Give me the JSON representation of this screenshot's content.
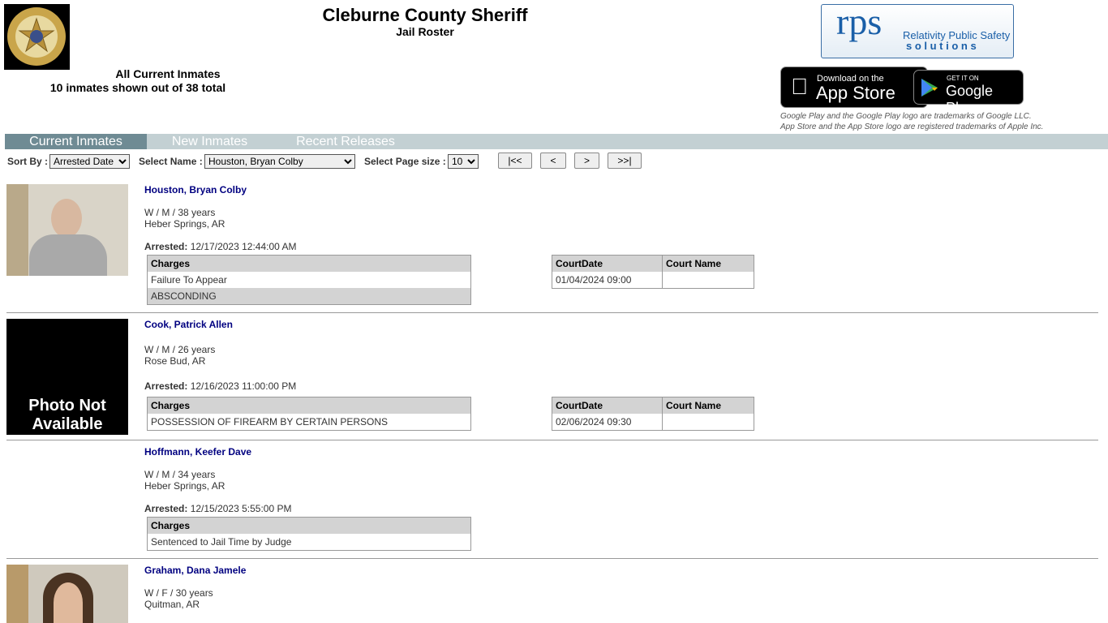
{
  "header": {
    "title": "Cleburne County Sheriff",
    "subtitle": "Jail Roster",
    "seal_text": "SHERIFF'S OFFICE CLEBURNE COUNTY",
    "summary_title": "All Current Inmates",
    "summary_count": "10 inmates shown out of 38 total"
  },
  "vendor": {
    "logo_text": "rps",
    "tagline_1": "Relativity Public Safety",
    "tagline_2": "s o l u t i o n s"
  },
  "apps": {
    "appstore_small": "Download on the",
    "appstore_big": "App Store",
    "gplay_small": "GET IT ON",
    "gplay_big": "Google Play",
    "tm1": "Google Play and the Google Play logo are trademarks of Google LLC.",
    "tm2": "App Store and the App Store logo are registered trademarks of Apple Inc."
  },
  "tabs": [
    {
      "label": "Current Inmates",
      "active": true
    },
    {
      "label": "New Inmates"
    },
    {
      "label": "Recent Releases"
    }
  ],
  "controls": {
    "sort_label": "Sort By :",
    "sort_value": "Arrested Date",
    "name_label": "Select Name :",
    "name_value": "Houston, Bryan Colby",
    "size_label": "Select Page size :",
    "size_value": "10",
    "first": "|<<",
    "prev": "<",
    "next": ">",
    "last": ">>|"
  },
  "labels": {
    "arrested": "Arrested:",
    "charges": "Charges",
    "court_date": "CourtDate",
    "court_name": "Court Name",
    "no_photo": "Photo Not Available"
  },
  "inmates": [
    {
      "name": "Houston, Bryan Colby",
      "demo": "W / M / 38 years",
      "city": "Heber Springs, AR",
      "arrested": "12/17/2023 12:44:00 AM",
      "charges": [
        "Failure To Appear",
        "ABSCONDING"
      ],
      "court": [
        {
          "date": "01/04/2024 09:00",
          "name": ""
        }
      ]
    },
    {
      "name": "Cook, Patrick Allen",
      "demo": "W / M / 26 years",
      "city": "Rose Bud, AR",
      "arrested": "12/16/2023 11:00:00 PM",
      "charges": [
        "POSSESSION OF FIREARM BY CERTAIN PERSONS"
      ],
      "court": [
        {
          "date": "02/06/2024 09:30",
          "name": ""
        }
      ]
    },
    {
      "name": "Hoffmann, Keefer Dave",
      "demo": "W / M / 34 years",
      "city": "Heber Springs, AR",
      "arrested": "12/15/2023 5:55:00 PM",
      "charges": [
        "Sentenced to Jail Time by Judge"
      ]
    },
    {
      "name": "Graham, Dana Jamele",
      "demo": "W / F / 30 years",
      "city": "Quitman, AR"
    }
  ]
}
